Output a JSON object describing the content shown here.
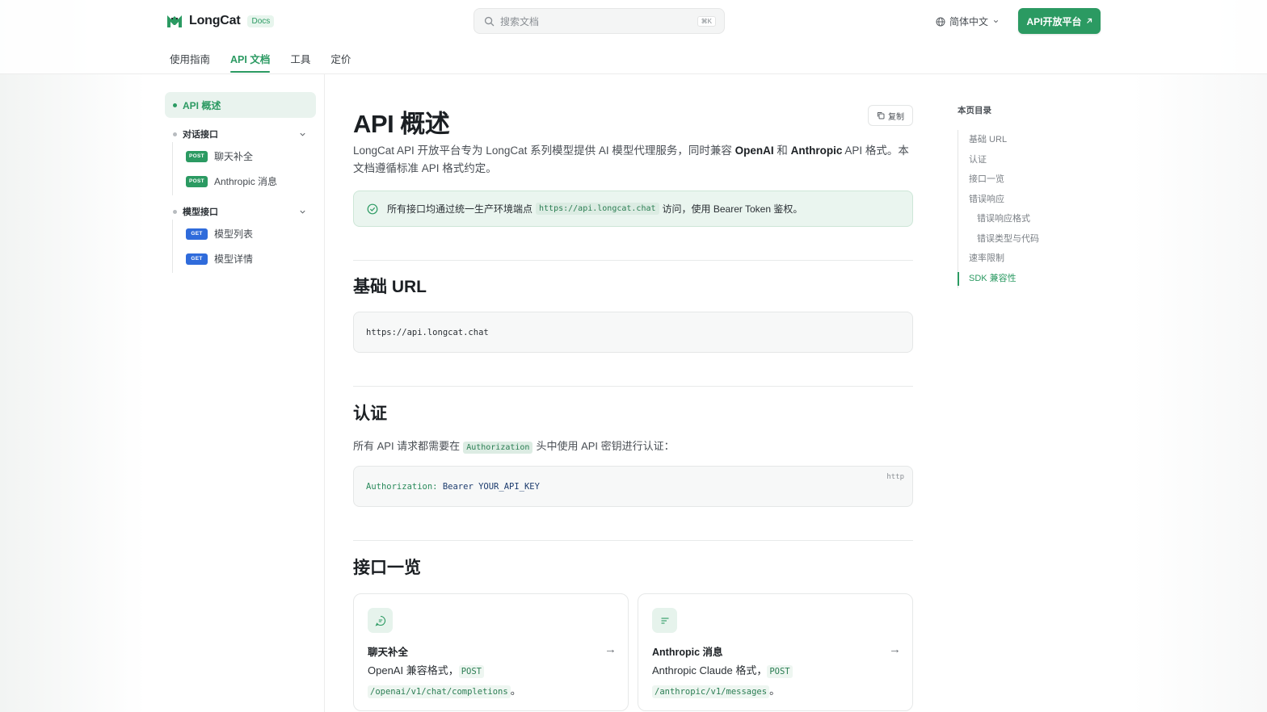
{
  "header": {
    "brand": "LongCat",
    "badge": "Docs",
    "search_placeholder": "搜索文档",
    "search_shortcut": "⌘K",
    "language": "简体中文",
    "cta": "API开放平台",
    "nav": [
      "使用指南",
      "API 文档",
      "工具",
      "定价"
    ],
    "nav_active": "API 文档"
  },
  "sidebar": {
    "overview": "API 概述",
    "groups": [
      {
        "label": "对话接口",
        "items": [
          {
            "method": "POST",
            "label": "聊天补全"
          },
          {
            "method": "POST",
            "label": "Anthropic 消息"
          }
        ]
      },
      {
        "label": "模型接口",
        "items": [
          {
            "method": "GET",
            "label": "模型列表"
          },
          {
            "method": "GET",
            "label": "模型详情"
          }
        ]
      }
    ]
  },
  "main": {
    "title": "API 概述",
    "copy_label": "复制",
    "intro_part1": "LongCat API 开放平台专为 LongCat 系列模型提供 AI 模型代理服务，同时兼容 ",
    "intro_openai": "OpenAI",
    "intro_and": " 和 ",
    "intro_anthropic": "Anthropic",
    "intro_part2": " API 格式。本文档遵循标准 API 格式约定。",
    "callout_pre": "所有接口均通过统一生产环境端点",
    "callout_code": "https://api.longcat.chat",
    "callout_post": "访问，使用 Bearer Token 鉴权。",
    "base_url_heading": "基础 URL",
    "base_url": "https://api.longcat.chat",
    "auth_heading": "认证",
    "auth_pre": "所有 API 请求都需要在",
    "auth_code": "Authorization",
    "auth_post": "头中使用 API 密钥进行认证：",
    "auth_block_key": "Authorization:",
    "auth_block_value": "Bearer YOUR_API_KEY",
    "auth_block_lang": "http",
    "endpoints_heading": "接口一览",
    "cards": [
      {
        "title": "聊天补全",
        "desc_pre": "OpenAI 兼容格式，",
        "method": "POST",
        "path": "/openai/v1/chat/completions",
        "desc_post": "。",
        "arrow": "→"
      },
      {
        "title": "Anthropic 消息",
        "desc_pre": "Anthropic Claude 格式，",
        "method": "POST",
        "path": "/anthropic/v1/messages",
        "desc_post": "。",
        "arrow": "→"
      }
    ]
  },
  "toc": {
    "title": "本页目录",
    "items": [
      "基础 URL",
      "认证",
      "接口一览",
      "错误响应",
      "错误响应格式",
      "错误类型与代码",
      "速率限制",
      "SDK 兼容性"
    ],
    "active": "SDK 兼容性"
  },
  "colors": {
    "accent": "#2b9a62",
    "get": "#2f6bdb"
  }
}
